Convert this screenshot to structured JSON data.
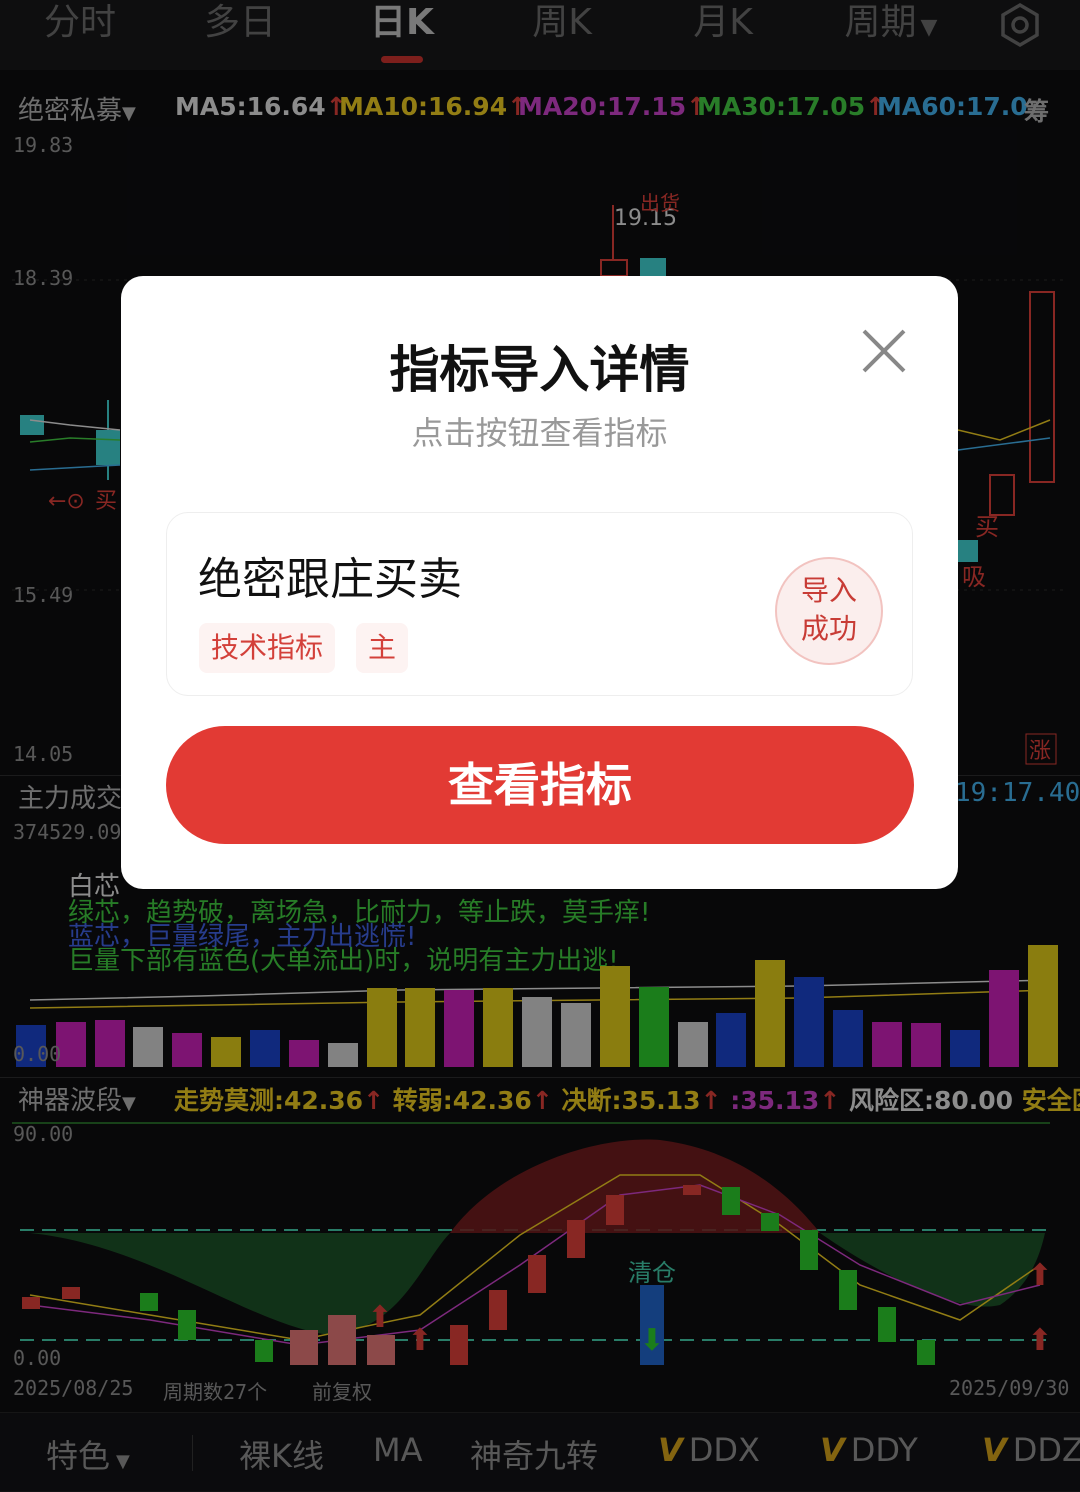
{
  "tabs": [
    "分时",
    "多日",
    "日K",
    "周K",
    "月K",
    "周期"
  ],
  "active_tab": "日K",
  "settings_icon": "gear-icon",
  "main_indicator": {
    "name": "绝密私募",
    "ma": [
      {
        "label": "MA5:16.64",
        "color": "#d8d8d8"
      },
      {
        "label": "MA10:16.94",
        "color": "#e0c020"
      },
      {
        "label": "MA20:17.15",
        "color": "#c040c0"
      },
      {
        "label": "MA30:17.05",
        "color": "#40c040"
      },
      {
        "label": "MA60:17.0",
        "color": "#40a8e0"
      }
    ],
    "ma_trailing": "筹",
    "price_axis": [
      "19.83",
      "18.39",
      "15.49",
      "14.05"
    ],
    "chart_labels": {
      "peak_price": "19.15",
      "peak_tag": "出货",
      "buy_left": "买",
      "buy_right": "买",
      "absorb": "吸",
      "rise": "涨"
    }
  },
  "volume_panel": {
    "name": "主力成交",
    "top_value": "374529.09",
    "right_value": "19:17.40",
    "zero": "0.00",
    "legend_lines": [
      {
        "text": "绿芯，趋势破，离场急，比耐力，等止跌，莫手痒!",
        "color": "#3cbf3c"
      },
      {
        "text": "蓝芯，巨量绿尾，主力出逃慌!",
        "color": "#3c5cd8"
      },
      {
        "text": "巨量下部有蓝色(大单流出)时，说明有主力出逃!",
        "color": "#3cbf3c"
      }
    ],
    "legend_partial": "白芯"
  },
  "wave_panel": {
    "name": "神器波段",
    "stats": [
      {
        "label": "走势莫测:42.36",
        "color": "#e0c020"
      },
      {
        "label": "转弱:42.36",
        "color": "#e0c020"
      },
      {
        "label": "决断:35.13",
        "color": "#e0c020"
      },
      {
        "label": ":35.13",
        "color": "#c040c0"
      },
      {
        "label": "风险区:80.00",
        "color": "#d8d8d8"
      },
      {
        "label": "安全区",
        "color": "#e0c020"
      }
    ],
    "top_value": "90.00",
    "zero": "0.00",
    "clear_label": "清仓"
  },
  "footer_info": {
    "start_date": "2025/08/25",
    "count": "周期数27个",
    "adjust": "前复权",
    "end_date": "2025/09/30"
  },
  "bottom_bar": {
    "items": [
      "特色",
      "裸K线",
      "MA",
      "神奇九转"
    ],
    "v_items": [
      "DDX",
      "DDY",
      "DDZ"
    ],
    "v_mark": "V"
  },
  "modal": {
    "title": "指标导入详情",
    "subtitle": "点击按钮查看指标",
    "indicator_name": "绝密跟庄买卖",
    "tags": [
      "技术指标",
      "主"
    ],
    "badge_line1": "导入",
    "badge_line2": "成功",
    "button_label": "查看指标",
    "accent": "#e23a34"
  }
}
